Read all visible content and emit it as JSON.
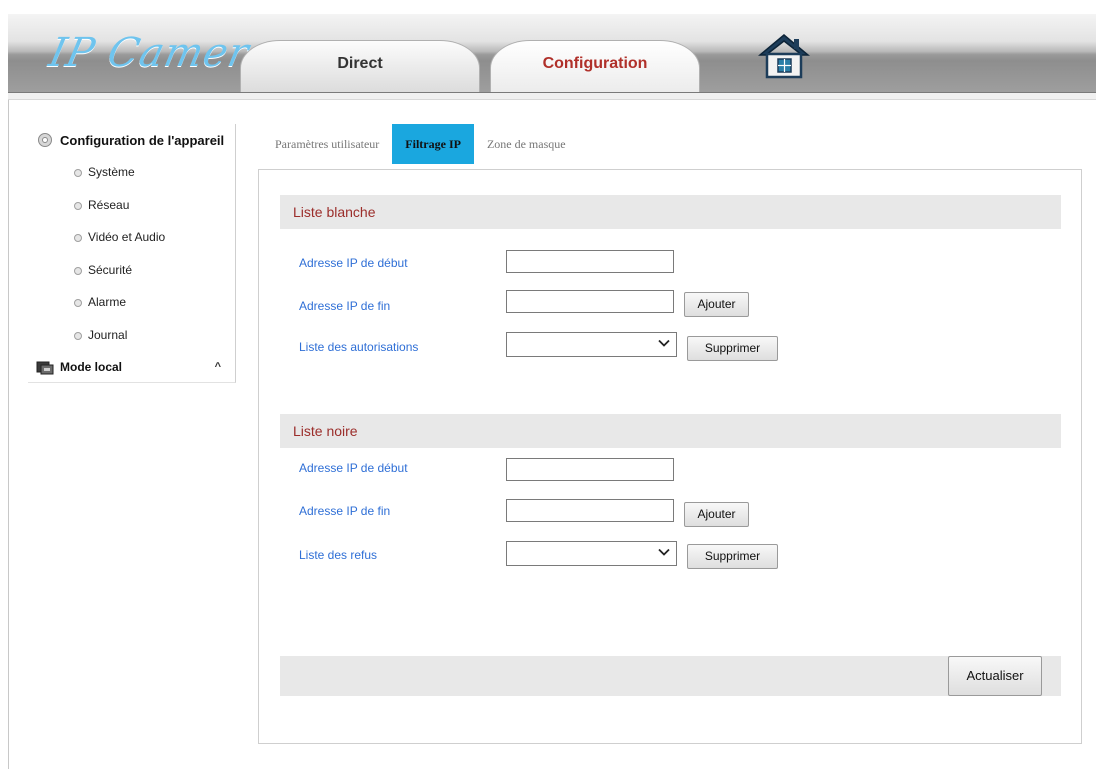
{
  "header": {
    "logo_text": "IP Camera",
    "tabs": [
      {
        "label": "Direct",
        "active": false
      },
      {
        "label": "Configuration",
        "active": true
      }
    ],
    "home_icon": "home-icon"
  },
  "sidebar": {
    "section_title": "Configuration de l'appareil",
    "section_icon": "gear-icon",
    "items": [
      {
        "label": "Système"
      },
      {
        "label": "Réseau"
      },
      {
        "label": "Vidéo et Audio"
      },
      {
        "label": "Sécurité"
      },
      {
        "label": "Alarme"
      },
      {
        "label": "Journal"
      }
    ],
    "local_mode": {
      "label": "Mode local",
      "icon": "local-mode-icon",
      "caret": "^"
    }
  },
  "subtabs": [
    {
      "label": "Paramètres utilisateur",
      "active": false
    },
    {
      "label": "Filtrage IP",
      "active": true
    },
    {
      "label": "Zone de masque",
      "active": false
    }
  ],
  "whitelist": {
    "title": "Liste blanche",
    "start_ip_label": "Adresse IP de début",
    "start_ip_value": "",
    "end_ip_label": "Adresse IP de fin",
    "end_ip_value": "",
    "add_label": "Ajouter",
    "list_label": "Liste des autorisations",
    "list_selected": "",
    "delete_label": "Supprimer"
  },
  "blacklist": {
    "title": "Liste noire",
    "start_ip_label": "Adresse IP de début",
    "start_ip_value": "",
    "end_ip_label": "Adresse IP de fin",
    "end_ip_value": "",
    "add_label": "Ajouter",
    "list_label": "Liste des refus",
    "list_selected": "",
    "delete_label": "Supprimer"
  },
  "footer": {
    "refresh_label": "Actualiser"
  },
  "colors": {
    "accent_tab": "#1aa7df",
    "section_title": "#9b2d2a",
    "field_label": "#2f6fd6",
    "logo": "#6fc4ee",
    "config_tab_text": "#b0302a"
  }
}
